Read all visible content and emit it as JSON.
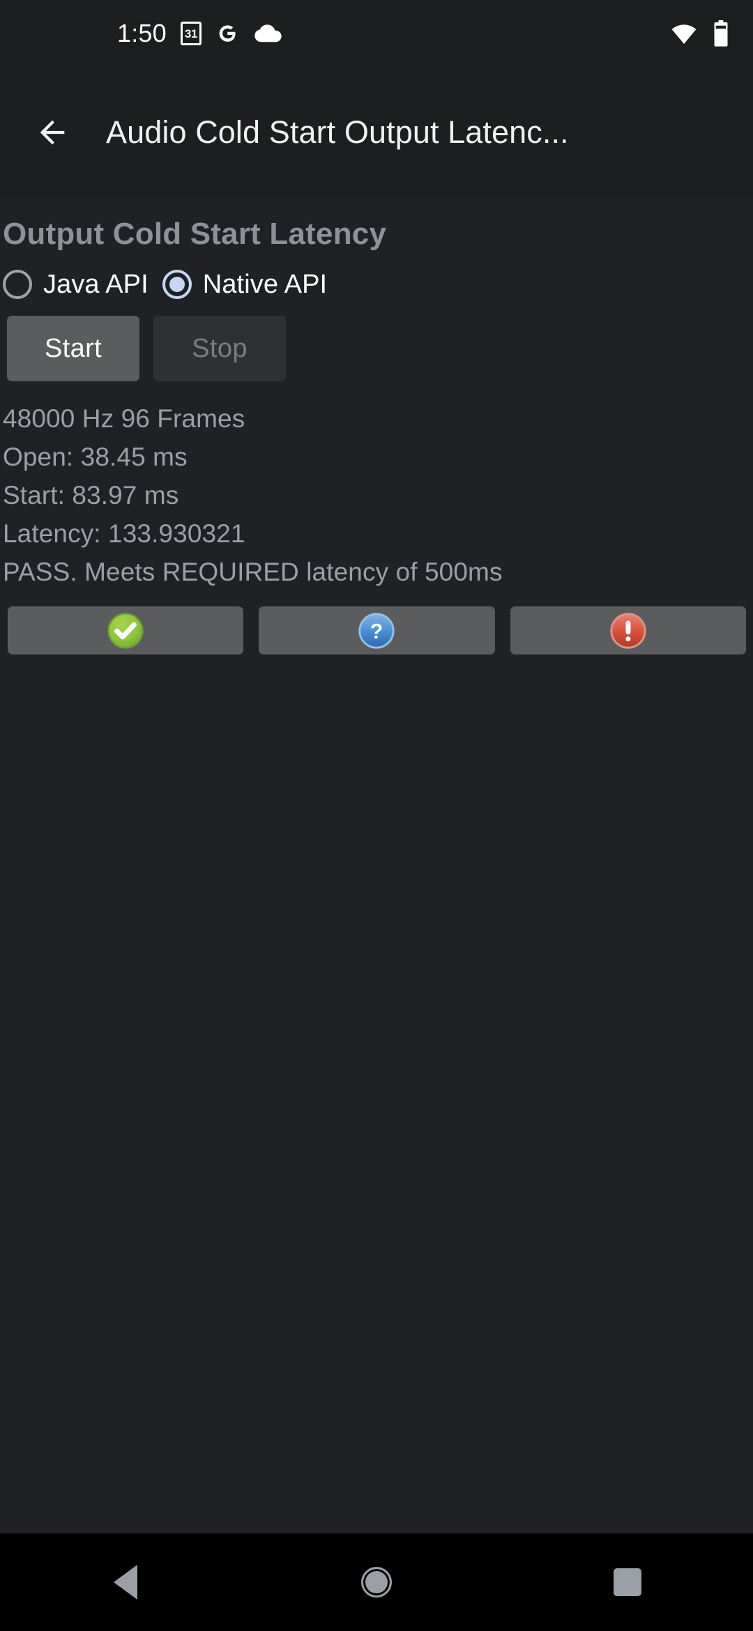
{
  "status_bar": {
    "clock": "1:50",
    "calendar_day": "31",
    "icons": [
      "calendar-icon",
      "google-icon",
      "cloud-icon",
      "wifi-icon",
      "battery-icon"
    ]
  },
  "app_bar": {
    "back_icon": "back-arrow-icon",
    "title": "Audio Cold Start Output Latenc..."
  },
  "main": {
    "section_title": "Output Cold Start Latency",
    "api_options": [
      {
        "label": "Java API",
        "selected": false
      },
      {
        "label": "Native API",
        "selected": true
      }
    ],
    "controls": {
      "start_label": "Start",
      "start_enabled": true,
      "stop_label": "Stop",
      "stop_enabled": false
    },
    "results": [
      "48000 Hz 96 Frames",
      "Open: 38.45 ms",
      "Start: 83.97 ms",
      "Latency: 133.930321",
      "PASS. Meets REQUIRED latency of 500ms"
    ],
    "verdict_buttons": [
      {
        "icon": "pass-check-icon",
        "color": "#8cc63e"
      },
      {
        "icon": "info-question-icon",
        "color": "#4a8fd4"
      },
      {
        "icon": "fail-exclamation-icon",
        "color": "#d9543f"
      }
    ]
  },
  "nav_bar": {
    "buttons": [
      "back-triangle-icon",
      "home-circle-icon",
      "recents-square-icon"
    ]
  },
  "colors": {
    "window_background": "#202124",
    "bar_background": "#1d1e20",
    "accent_radio": "#c6d7f6",
    "muted_text": "#9aa0a6",
    "button_enabled": "#5b5c5e",
    "button_disabled": "#2f3032"
  }
}
